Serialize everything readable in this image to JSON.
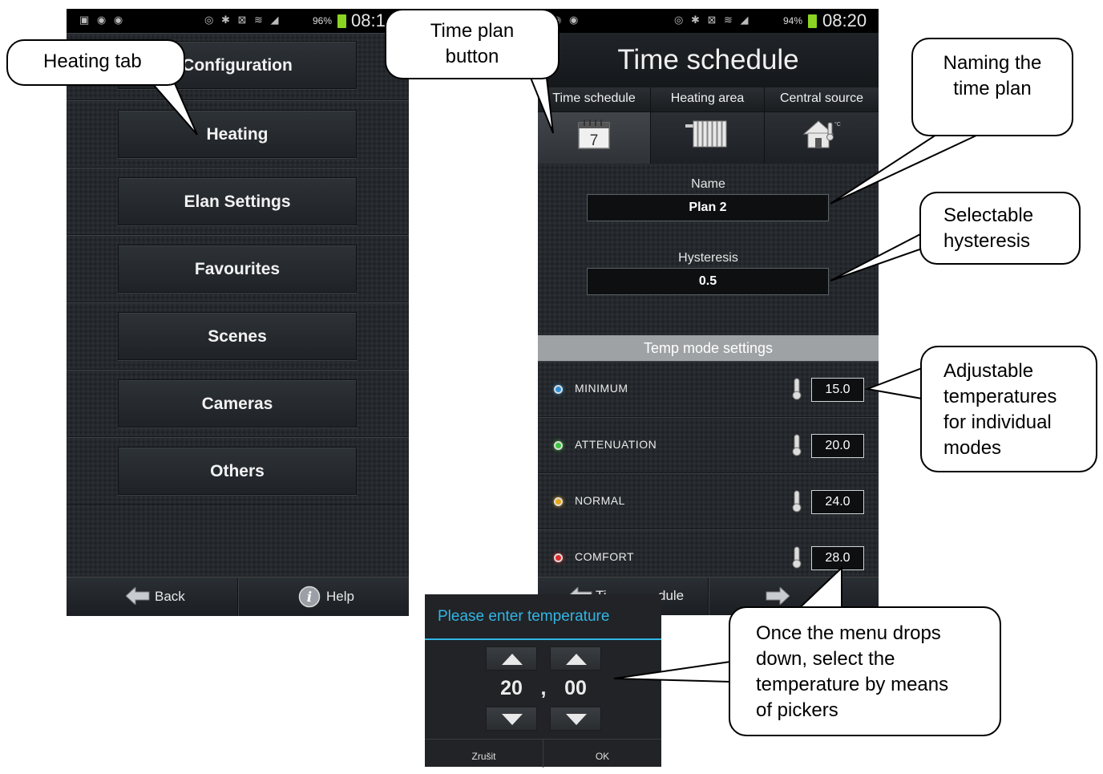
{
  "left_phone": {
    "status": {
      "battery": "96%",
      "time": "08:1"
    },
    "menu_items": [
      "Configuration",
      "Heating",
      "Elan Settings",
      "Favourites",
      "Scenes",
      "Cameras",
      "Others"
    ],
    "bottom": {
      "back": "Back",
      "help": "Help"
    }
  },
  "right_phone": {
    "status": {
      "battery": "94%",
      "time": "08:20"
    },
    "title": "Time schedule",
    "tabs": [
      {
        "label": "Time schedule",
        "icon": "calendar-icon",
        "icon_text": "7"
      },
      {
        "label": "Heating area",
        "icon": "radiator-icon"
      },
      {
        "label": "Central source",
        "icon": "house-temperature-icon"
      }
    ],
    "name_label": "Name",
    "name_value": "Plan 2",
    "hysteresis_label": "Hysteresis",
    "hysteresis_value": "0.5",
    "temp_section": "Temp mode settings",
    "modes": [
      {
        "name": "MINIMUM",
        "value": "15.0",
        "color": "#2f8fd8"
      },
      {
        "name": "ATTENUATION",
        "value": "20.0",
        "color": "#3cc43c"
      },
      {
        "name": "NORMAL",
        "value": "24.0",
        "color": "#e8a81c"
      },
      {
        "name": "COMFORT",
        "value": "28.0",
        "color": "#e02a2a"
      }
    ],
    "bottom": {
      "back_partial": "Ti",
      "back_partial2": "dule"
    }
  },
  "dialog": {
    "title": "Please enter temperature",
    "integer": "20",
    "separator": ",",
    "fraction": "00",
    "cancel": "Zrušit",
    "ok": "OK"
  },
  "callouts": {
    "heating_tab": "Heating tab",
    "time_plan": [
      "Time plan",
      "button"
    ],
    "naming": [
      "Naming the",
      "time plan"
    ],
    "hysteresis": [
      "Selectable",
      "hysteresis"
    ],
    "temperatures": [
      "Adjustable",
      "temperatures",
      "for individual",
      "modes"
    ],
    "pickers": [
      "Once the menu drops",
      "down, select the",
      "temperature by means",
      "of pickers"
    ]
  }
}
